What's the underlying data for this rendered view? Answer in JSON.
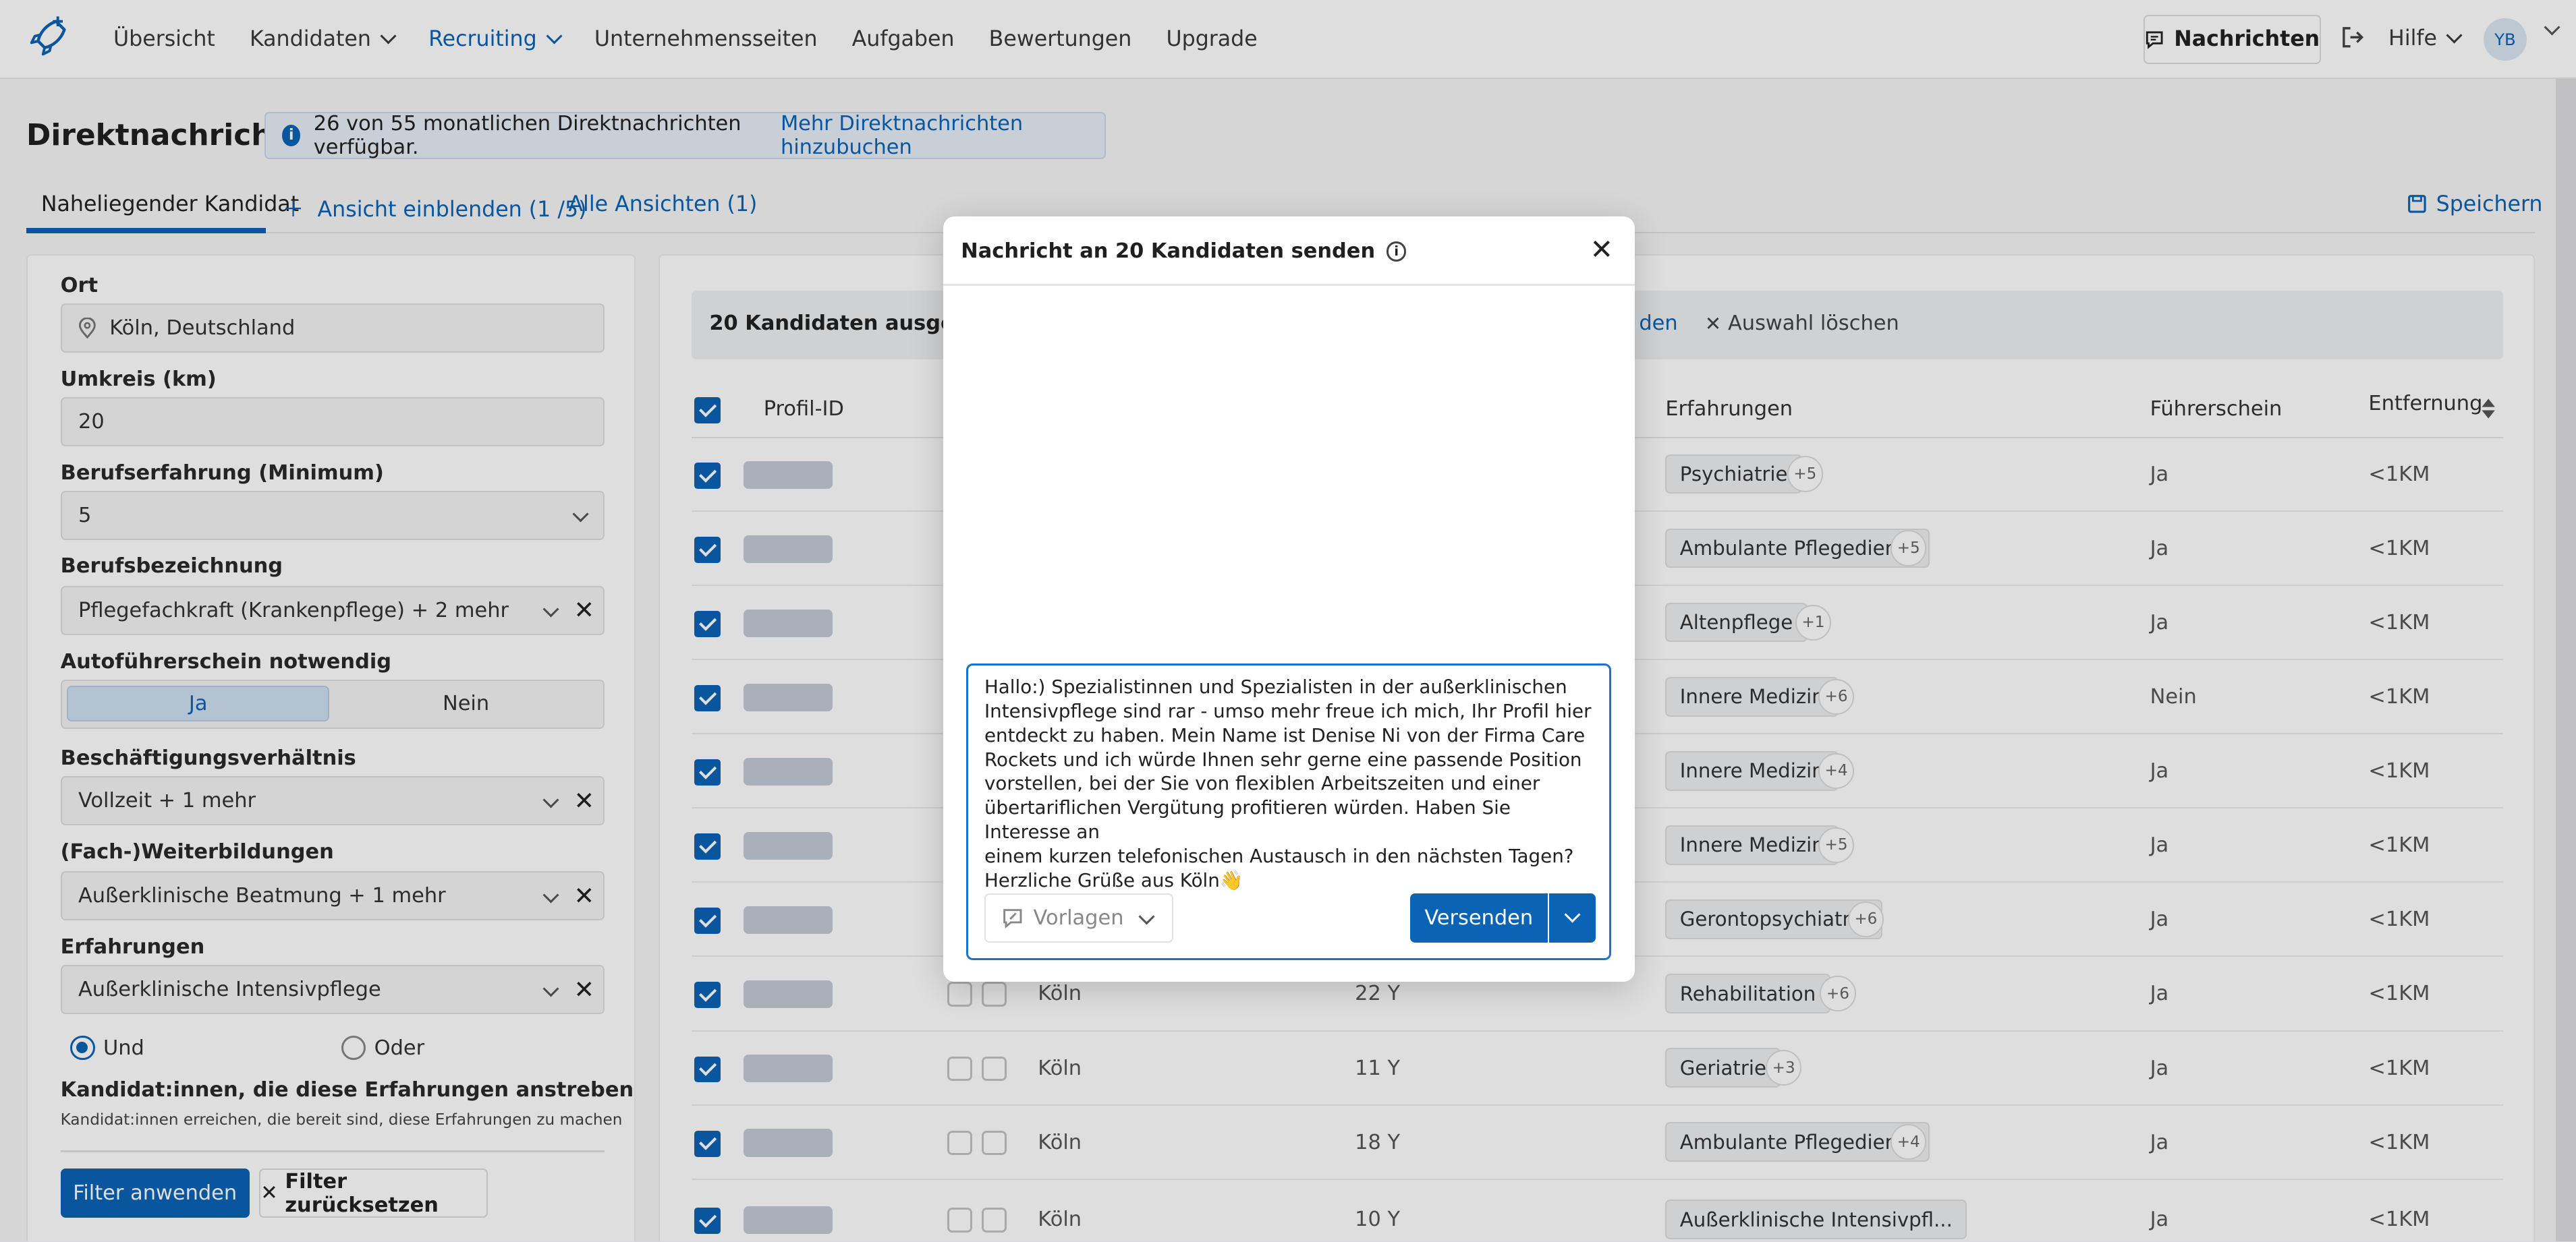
{
  "nav": {
    "items": [
      "Übersicht",
      "Kandidaten",
      "Recruiting",
      "Unternehmensseiten",
      "Aufgaben",
      "Bewertungen",
      "Upgrade"
    ],
    "messages_button": "Nachrichten",
    "help": "Hilfe",
    "avatar_initials": "YB"
  },
  "header": {
    "title": "Direktnachrichten",
    "info_text": "26 von 55 monatlichen Direktnachrichten verfügbar.",
    "info_link": "Mehr Direktnachrichten hinzubuchen"
  },
  "tabs": {
    "active": "Naheliegender Kandidat",
    "add_view": "Ansicht einblenden (1 /5)",
    "all_views": "Alle Ansichten (1)",
    "save": "Speichern"
  },
  "filters": {
    "ort_label": "Ort",
    "ort_value": "Köln, Deutschland",
    "umkreis_label": "Umkreis (km)",
    "umkreis_value": "20",
    "erfahrung_label": "Berufserfahrung (Minimum)",
    "erfahrung_value": "5",
    "beruf_label": "Berufsbezeichnung",
    "beruf_value": "Pflegefachkraft (Krankenpflege) + 2 mehr",
    "fuehrerschein_label": "Autoführerschein notwendig",
    "fuehrerschein_yes": "Ja",
    "fuehrerschein_no": "Nein",
    "beschaeftigung_label": "Beschäftigungsverhältnis",
    "beschaeftigung_value": "Vollzeit + 1 mehr",
    "weiterbildung_label": "(Fach-)Weiterbildungen",
    "weiterbildung_value": "Außerklinische Beatmung + 1 mehr",
    "erfahrungen_label": "Erfahrungen",
    "erfahrungen_value": "Außerklinische Intensivpflege",
    "radio_und": "Und",
    "radio_oder": "Oder",
    "anstreben_label": "Kandidat:innen, die diese Erfahrungen anstreben",
    "anstreben_hint": "Kandidat:innen erreichen, die bereit sind, diese Erfahrungen zu machen",
    "apply": "Filter anwenden",
    "reset": "Filter zurücksetzen"
  },
  "table": {
    "selected_text": "20 Kandidaten ausgewählt",
    "selected_fragment": "den",
    "clear_selection": "Auswahl löschen",
    "headers": {
      "profil": "Profil-ID",
      "erfahrungen": "Erfahrungen",
      "fuehrerschein": "Führerschein",
      "entfernung": "Entfernung"
    },
    "rows": [
      {
        "ort": "",
        "alter": "",
        "erfahrung": "Psychiatrie",
        "more": "+5",
        "fs": "Ja",
        "ent": "<1KM"
      },
      {
        "ort": "",
        "alter": "",
        "erfahrung": "Ambulante Pflegedienst",
        "more": "+5",
        "fs": "Ja",
        "ent": "<1KM"
      },
      {
        "ort": "",
        "alter": "",
        "erfahrung": "Altenpflege",
        "more": "+1",
        "fs": "Ja",
        "ent": "<1KM"
      },
      {
        "ort": "",
        "alter": "",
        "erfahrung": "Innere Medizin",
        "more": "+6",
        "fs": "Nein",
        "ent": "<1KM"
      },
      {
        "ort": "",
        "alter": "",
        "erfahrung": "Innere Medizin",
        "more": "+4",
        "fs": "Ja",
        "ent": "<1KM"
      },
      {
        "ort": "",
        "alter": "",
        "erfahrung": "Innere Medizin",
        "more": "+5",
        "fs": "Ja",
        "ent": "<1KM"
      },
      {
        "ort": "",
        "alter": "",
        "erfahrung": "Gerontopsychiatrie",
        "more": "+6",
        "fs": "Ja",
        "ent": "<1KM"
      },
      {
        "ort": "Köln",
        "alter": "22 Y",
        "erfahrung": "Rehabilitation",
        "more": "+6",
        "fs": "Ja",
        "ent": "<1KM"
      },
      {
        "ort": "Köln",
        "alter": "11 Y",
        "erfahrung": "Geriatrie",
        "more": "+3",
        "fs": "Ja",
        "ent": "<1KM"
      },
      {
        "ort": "Köln",
        "alter": "18 Y",
        "erfahrung": "Ambulante Pflegedienst",
        "more": "+4",
        "fs": "Ja",
        "ent": "<1KM"
      },
      {
        "ort": "Köln",
        "alter": "10 Y",
        "erfahrung": "Außerklinische Intensivpfl...",
        "more": "",
        "fs": "Ja",
        "ent": "<1KM"
      }
    ]
  },
  "modal": {
    "title": "Nachricht an 20 Kandidaten senden",
    "message": "Hallo:) Spezialistinnen und Spezialisten in der außerklinischen\nIntensivpflege sind rar - umso mehr freue ich mich, Ihr Profil hier\nentdeckt zu haben. Mein Name ist Denise Ni von der Firma Care\nRockets und ich würde Ihnen sehr gerne eine passende Position\nvorstellen, bei der Sie von flexiblen Arbeitszeiten und einer\nübertariflichen Vergütung profitieren würden. Haben Sie Interesse an\neinem kurzen telefonischen Austausch in den nächsten Tagen?\nHerzliche Grüße aus Köln👋",
    "templates": "Vorlagen",
    "send": "Versenden"
  },
  "colors": {
    "accent": "#0b63b6",
    "accent_light": "#cfe0f2"
  }
}
